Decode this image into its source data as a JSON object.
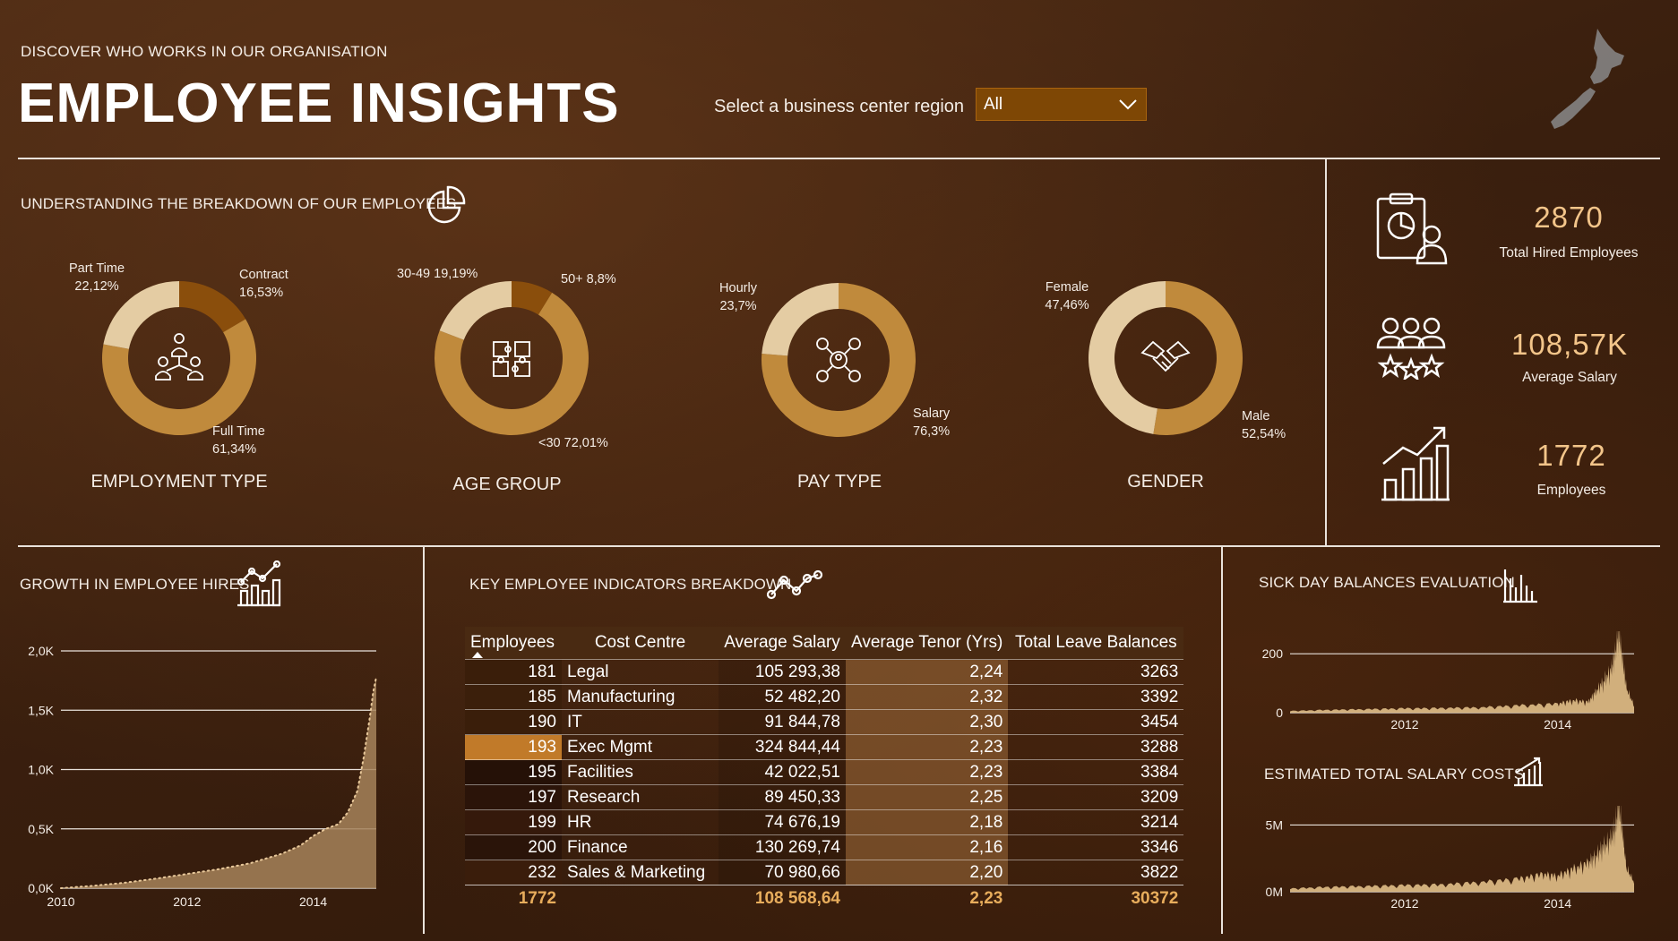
{
  "header": {
    "subtitle": "DISCOVER WHO WORKS IN OUR ORGANISATION",
    "title": "EMPLOYEE INSIGHTS",
    "region_label": "Select a business center region",
    "region_value": "All"
  },
  "breakdown": {
    "heading": "UNDERSTANDING THE BREAKDOWN OF OUR EMPLOYEES",
    "colors": {
      "dark": "#8a4e0c",
      "mid": "#c08a3c",
      "light": "#e4cca3"
    }
  },
  "kpis": [
    {
      "value": "2870",
      "label": "Total Hired Employees",
      "icon": "clipboard-person-icon"
    },
    {
      "value": "108,57K",
      "label": "Average Salary",
      "icon": "team-stars-icon"
    },
    {
      "value": "1772",
      "label": "Employees",
      "icon": "growth-bars-icon"
    }
  ],
  "growth": {
    "heading": "GROWTH IN EMPLOYEE HIRES"
  },
  "indicators": {
    "heading": "KEY EMPLOYEE INDICATORS BREAKDOWN",
    "columns": [
      "Employees",
      "Cost Centre",
      "Average Salary",
      "Average Tenor (Yrs)",
      "Total Leave Balances"
    ],
    "rows": [
      [
        "181",
        "Legal",
        "105 293,38",
        "2,24",
        "3263"
      ],
      [
        "185",
        "Manufacturing",
        "52 482,20",
        "2,32",
        "3392"
      ],
      [
        "190",
        "IT",
        "91 844,78",
        "2,30",
        "3454"
      ],
      [
        "193",
        "Exec Mgmt",
        "324 844,44",
        "2,23",
        "3288"
      ],
      [
        "195",
        "Facilities",
        "42 022,51",
        "2,23",
        "3384"
      ],
      [
        "197",
        "Research",
        "89 450,33",
        "2,25",
        "3209"
      ],
      [
        "199",
        "HR",
        "74 676,19",
        "2,18",
        "3214"
      ],
      [
        "200",
        "Finance",
        "130 269,74",
        "2,16",
        "3346"
      ],
      [
        "232",
        "Sales & Marketing",
        "70 980,66",
        "2,20",
        "3822"
      ]
    ],
    "totals": [
      "1772",
      "",
      "108 568,64",
      "2,23",
      "30372"
    ]
  },
  "sick": {
    "heading": "SICK DAY BALANCES EVALUATION"
  },
  "salary": {
    "heading": "ESTIMATED TOTAL SALARY COSTS"
  },
  "chart_data": [
    {
      "type": "pie",
      "title": "EMPLOYMENT TYPE",
      "slices": [
        {
          "label": "Contract",
          "display": "16,53%",
          "value": 16.53,
          "color": "#8a4e0c"
        },
        {
          "label": "Full Time",
          "display": "61,34%",
          "value": 61.34,
          "color": "#c08a3c"
        },
        {
          "label": "Part Time",
          "display": "22,12%",
          "value": 22.12,
          "color": "#e4cca3"
        }
      ]
    },
    {
      "type": "pie",
      "title": "AGE GROUP",
      "slices": [
        {
          "label": "50+",
          "display": "8,8%",
          "value": 8.8,
          "color": "#8a4e0c"
        },
        {
          "label": "<30",
          "display": "72,01%",
          "value": 72.01,
          "color": "#c08a3c"
        },
        {
          "label": "30-49",
          "display": "19,19%",
          "value": 19.19,
          "color": "#e4cca3"
        }
      ]
    },
    {
      "type": "pie",
      "title": "PAY TYPE",
      "slices": [
        {
          "label": "Salary",
          "display": "76,3%",
          "value": 76.3,
          "color": "#c08a3c"
        },
        {
          "label": "Hourly",
          "display": "23,7%",
          "value": 23.7,
          "color": "#e4cca3"
        }
      ]
    },
    {
      "type": "pie",
      "title": "GENDER",
      "slices": [
        {
          "label": "Male",
          "display": "52,54%",
          "value": 52.54,
          "color": "#c08a3c"
        },
        {
          "label": "Female",
          "display": "47,46%",
          "value": 47.46,
          "color": "#e4cca3"
        }
      ]
    },
    {
      "type": "area",
      "ylim": [
        0,
        2000
      ],
      "yticks": [
        0,
        500,
        1000,
        1500,
        2000
      ],
      "ytick_labels": [
        "0,0K",
        "0,5K",
        "1,0K",
        "1,5K",
        "2,0K"
      ],
      "xlim": [
        2010,
        2015
      ],
      "xticks": [
        2010,
        2012,
        2014
      ],
      "x": [
        2010.0,
        2010.5,
        2011.0,
        2011.5,
        2012.0,
        2012.5,
        2013.0,
        2013.5,
        2013.8,
        2014.0,
        2014.2,
        2014.4,
        2014.55,
        2014.7,
        2014.8,
        2014.9,
        2014.95,
        2015.0
      ],
      "values": [
        0,
        20,
        45,
        80,
        120,
        160,
        210,
        290,
        360,
        440,
        500,
        540,
        640,
        820,
        1100,
        1450,
        1650,
        1780
      ],
      "color": "#a6835a"
    },
    {
      "type": "area",
      "ylim": [
        0,
        240
      ],
      "yticks": [
        0,
        200
      ],
      "ytick_labels": [
        "0",
        "200"
      ],
      "xlim": [
        2010.5,
        2015.0
      ],
      "xticks": [
        2012,
        2014
      ],
      "x": [
        2010.5,
        2011.0,
        2011.5,
        2012.0,
        2012.5,
        2013.0,
        2013.5,
        2014.0,
        2014.2,
        2014.4,
        2014.5,
        2014.6,
        2014.7,
        2014.75,
        2014.8,
        2014.85,
        2014.9,
        2015.0
      ],
      "values": [
        5,
        8,
        10,
        12,
        13,
        15,
        20,
        25,
        35,
        30,
        60,
        90,
        120,
        170,
        230,
        150,
        70,
        20
      ],
      "color": "#d9b783"
    },
    {
      "type": "area",
      "ylim": [
        0,
        5500000
      ],
      "yticks": [
        0,
        5000000
      ],
      "ytick_labels": [
        "0M",
        "5M"
      ],
      "xlim": [
        2010.5,
        2015.0
      ],
      "xticks": [
        2012,
        2014
      ],
      "x": [
        2010.5,
        2011.0,
        2011.5,
        2012.0,
        2012.5,
        2013.0,
        2013.5,
        2013.8,
        2014.0,
        2014.2,
        2014.4,
        2014.5,
        2014.6,
        2014.7,
        2014.75,
        2014.8,
        2014.85,
        2014.9,
        2015.0
      ],
      "values": [
        200000,
        300000,
        350000,
        400000,
        450000,
        600000,
        800000,
        1100000,
        1000000,
        1400000,
        1800000,
        2300000,
        2800000,
        3300000,
        4000000,
        5500000,
        3600000,
        1500000,
        600000
      ],
      "color": "#d9b783"
    }
  ]
}
